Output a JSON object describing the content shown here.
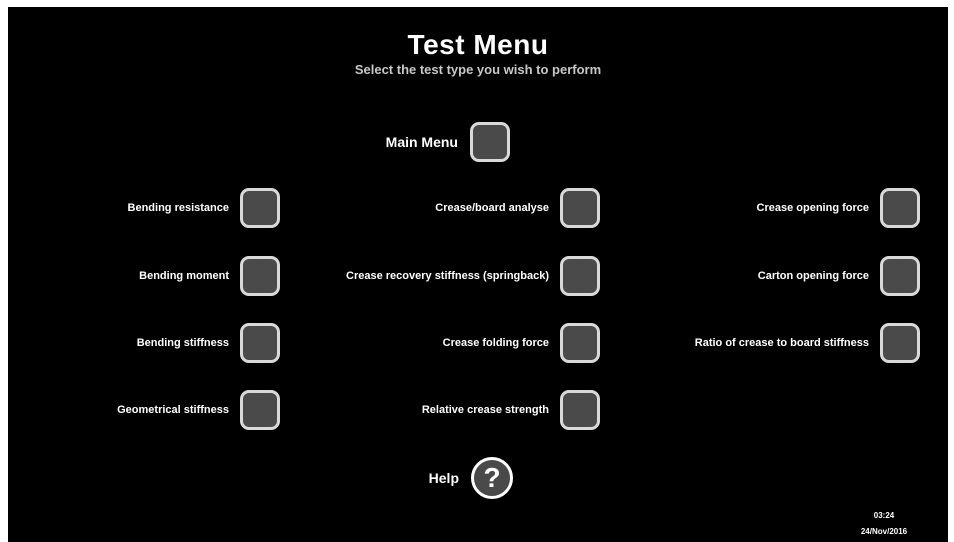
{
  "header": {
    "title": "Test Menu",
    "subtitle": "Select the test type you wish to perform"
  },
  "main_menu": {
    "label": "Main Menu"
  },
  "tests": {
    "bending_resistance": "Bending resistance",
    "bending_moment": "Bending moment",
    "bending_stiffness": "Bending stiffness",
    "geometrical_stiffness": "Geometrical stiffness",
    "crease_board_analyse": "Crease/board analyse",
    "crease_recovery_stiffness": "Crease recovery stiffness (springback)",
    "crease_folding_force": "Crease folding force",
    "relative_crease_strength": "Relative crease strength",
    "crease_opening_force": "Crease opening force",
    "carton_opening_force": "Carton opening force",
    "ratio_crease_board_stiffness": "Ratio of crease to board stiffness"
  },
  "help": {
    "label": "Help",
    "icon": "question-mark-icon",
    "glyph": "?"
  },
  "status": {
    "time": "03:24",
    "date": "24/Nov/2016"
  },
  "colors": {
    "background": "#000000",
    "button_fill": "#4a4a4a",
    "button_border": "#d9d9d9",
    "text": "#ffffff",
    "subtitle": "#c8c8c8"
  }
}
